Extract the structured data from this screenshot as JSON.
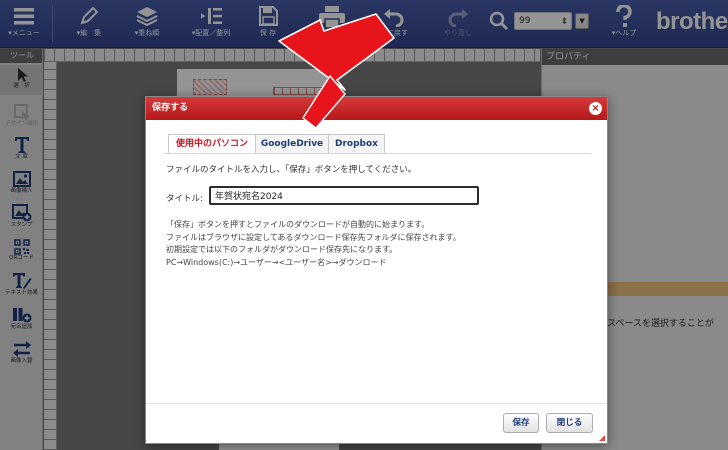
{
  "toolbar": {
    "menu_label": "▾メニュー",
    "edit_label": "▾編　集",
    "layers_label": "▾重ね順",
    "arrange_label": "▾配置／整列",
    "save_label": "保 存",
    "print_label": "",
    "undo_label": "元に戻す",
    "redo_label": "やり直し",
    "zoom_value": "99",
    "help_label": "▾ヘルプ",
    "brand": "brothe"
  },
  "tools": {
    "header": "ツール",
    "items": [
      {
        "label": "選　択"
      },
      {
        "label": "デザイン選択"
      },
      {
        "label": "文 章"
      },
      {
        "label": "画像挿入"
      },
      {
        "label": "スタンプ"
      },
      {
        "label": "QRコード"
      },
      {
        "label": "テキスト効果"
      },
      {
        "label": "宛名追加"
      },
      {
        "label": "画像入替"
      }
    ]
  },
  "properties": {
    "header": "プロパティ",
    "hint": "るスペースを選択することが"
  },
  "dialog": {
    "title": "保存する",
    "tabs": [
      {
        "label": "使用中のパソコン"
      },
      {
        "label": "GoogleDrive"
      },
      {
        "label": "Dropbox"
      }
    ],
    "instruction": "ファイルのタイトルを入力し、「保存」ボタンを押してください。",
    "title_label": "タイトル:",
    "title_value": "年賀状宛名2024",
    "notes": [
      "「保存」ボタンを押すとファイルのダウンロードが自動的に始まります。",
      "ファイルはブラウザに設定してあるダウンロード保存先フォルダに保存されます。",
      "初期設定では以下のフォルダがダウンロード保存先になります。",
      "PC→Windows(C:)→ユーザー→<ユーザー名>→ダウンロード"
    ],
    "save_button": "保存",
    "close_button": "閉じる"
  },
  "colors": {
    "toolbar": "#3a4d98",
    "dialog_title": "#c41f1f",
    "active_tab_text": "#d0121b",
    "arrow": "#e8141c"
  }
}
